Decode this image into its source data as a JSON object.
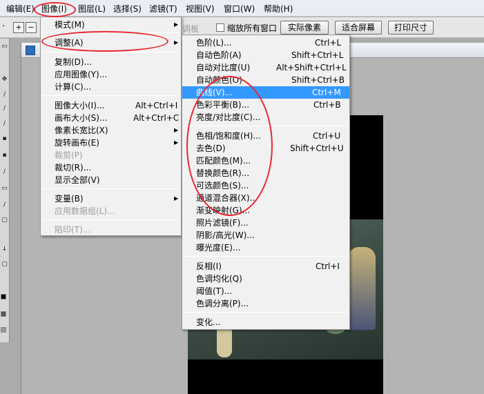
{
  "menubar": {
    "edit": "编辑(E)",
    "image": "图像(I)",
    "layer": "图层(L)",
    "select": "选择(S)",
    "filter": "滤镜(T)",
    "view": "视图(V)",
    "window": "窗口(W)",
    "help": "帮助(H)"
  },
  "options_bar": {
    "zoom_in_glyph": "+",
    "zoom_out_glyph": "−",
    "partial_text": "调板",
    "resize_all_windows_label": "缩放所有窗口",
    "actual_pixels": "实际像素",
    "fit_screen": "适合屏幕",
    "print_size": "打印尺寸"
  },
  "image_menu": {
    "items": [
      {
        "label": "模式(M)",
        "shortcut": "",
        "submenu": true
      },
      {
        "label": "调整(A)",
        "shortcut": "",
        "submenu": true
      },
      {
        "label": "复制(D)...",
        "shortcut": ""
      },
      {
        "label": "应用图像(Y)...",
        "shortcut": ""
      },
      {
        "label": "计算(C)...",
        "shortcut": ""
      },
      {
        "label": "图像大小(I)...",
        "shortcut": "Alt+Ctrl+I"
      },
      {
        "label": "画布大小(S)...",
        "shortcut": "Alt+Ctrl+C"
      },
      {
        "label": "像素长宽比(X)",
        "shortcut": "",
        "submenu": true
      },
      {
        "label": "旋转画布(E)",
        "shortcut": "",
        "submenu": true
      },
      {
        "label": "裁剪(P)",
        "shortcut": "",
        "disabled": true
      },
      {
        "label": "裁切(R)...",
        "shortcut": ""
      },
      {
        "label": "显示全部(V)",
        "shortcut": ""
      },
      {
        "label": "变量(B)",
        "shortcut": "",
        "submenu": true
      },
      {
        "label": "应用数据组(L)...",
        "shortcut": "",
        "disabled": true
      },
      {
        "label": "陷印(T)...",
        "shortcut": "",
        "disabled": true
      }
    ]
  },
  "adjust_menu": {
    "items": [
      {
        "label": "色阶(L)...",
        "shortcut": "Ctrl+L"
      },
      {
        "label": "自动色阶(A)",
        "shortcut": "Shift+Ctrl+L"
      },
      {
        "label": "自动对比度(U)",
        "shortcut": "Alt+Shift+Ctrl+L"
      },
      {
        "label": "自动颜色(O)",
        "shortcut": "Shift+Ctrl+B"
      },
      {
        "label": "曲线(V)...",
        "shortcut": "Ctrl+M",
        "highlighted": true
      },
      {
        "label": "色彩平衡(B)...",
        "shortcut": "Ctrl+B"
      },
      {
        "label": "亮度/对比度(C)...",
        "shortcut": ""
      },
      {
        "label": "色相/饱和度(H)...",
        "shortcut": "Ctrl+U"
      },
      {
        "label": "去色(D)",
        "shortcut": "Shift+Ctrl+U"
      },
      {
        "label": "匹配颜色(M)...",
        "shortcut": ""
      },
      {
        "label": "替换颜色(R)...",
        "shortcut": ""
      },
      {
        "label": "可选颜色(S)...",
        "shortcut": ""
      },
      {
        "label": "通道混合器(X)...",
        "shortcut": ""
      },
      {
        "label": "渐变映射(G)...",
        "shortcut": ""
      },
      {
        "label": "照片滤镜(F)...",
        "shortcut": ""
      },
      {
        "label": "阴影/高光(W)...",
        "shortcut": ""
      },
      {
        "label": "曝光度(E)...",
        "shortcut": ""
      },
      {
        "label": "反相(I)",
        "shortcut": "Ctrl+I"
      },
      {
        "label": "色调均化(Q)",
        "shortcut": ""
      },
      {
        "label": "阈值(T)...",
        "shortcut": ""
      },
      {
        "label": "色调分离(P)...",
        "shortcut": ""
      },
      {
        "label": "变化...",
        "shortcut": ""
      }
    ]
  },
  "colors": {
    "highlight": "#3399ff",
    "annotation": "#e8262d"
  }
}
